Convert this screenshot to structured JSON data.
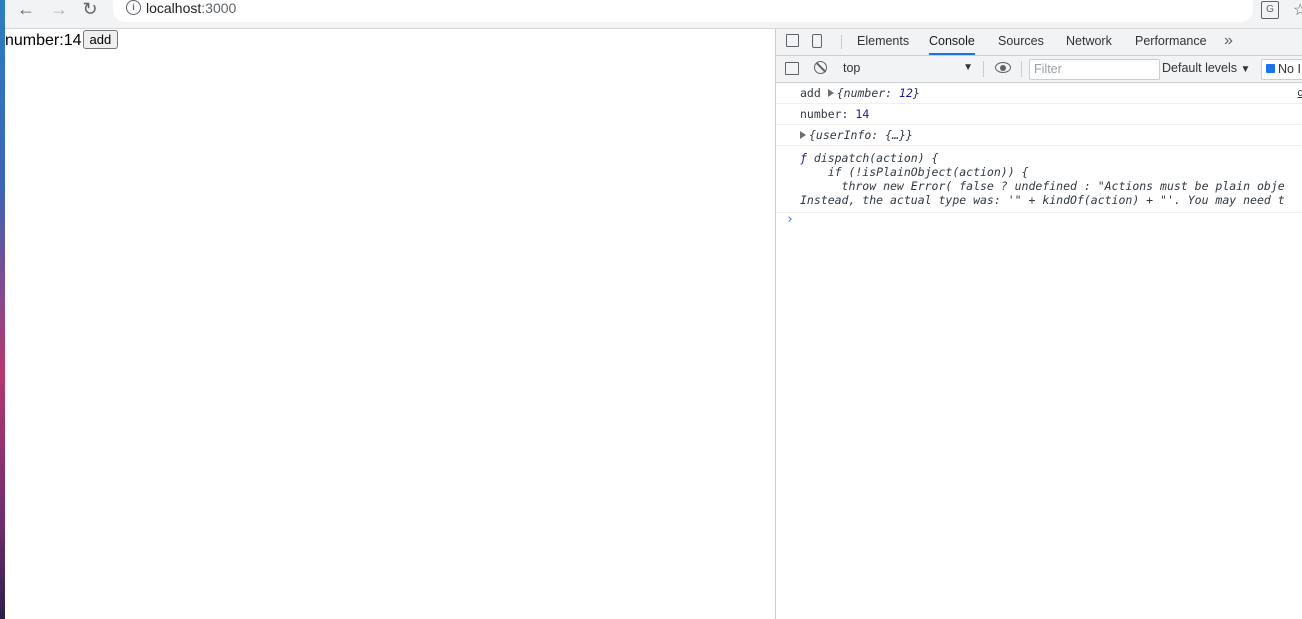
{
  "browser": {
    "url_host": "localhost",
    "url_port": ":3000"
  },
  "page": {
    "counter_label": "number:14",
    "add_button": "add"
  },
  "devtools": {
    "tabs": [
      "Elements",
      "Console",
      "Sources",
      "Network",
      "Performance"
    ],
    "active_tab": "Console",
    "toolbar": {
      "context": "top",
      "filter_placeholder": "Filter",
      "levels": "Default levels",
      "issues": "No I"
    },
    "console": {
      "line1_label": "add",
      "line1_obj_open": "{number: ",
      "line1_obj_value": "12",
      "line1_obj_close": "}",
      "line1_source": "c",
      "line2_key": "number:",
      "line2_value": "14",
      "line3_obj": "{userInfo: {…}}",
      "fn_line1_kw": "ƒ",
      "fn_line1": " dispatch(action) {",
      "fn_line2": "    if (!isPlainObject(action)) {",
      "fn_line3": "      throw new Error( false ? undefined : \"Actions must be plain obje",
      "fn_line4": "Instead, the actual type was: '\" + kindOf(action) + \"'. You may need t",
      "prompt": "›"
    }
  }
}
